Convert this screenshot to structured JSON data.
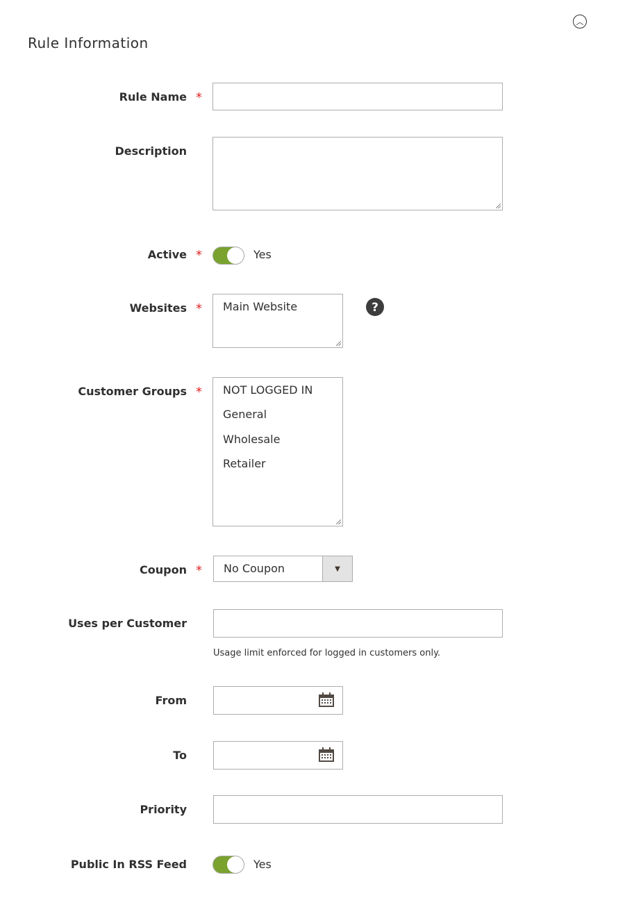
{
  "section": {
    "title": "Rule Information",
    "collapse_icon": "chevron-up-circle-icon"
  },
  "fields": {
    "rule_name": {
      "label": "Rule Name",
      "required": "*",
      "value": ""
    },
    "description": {
      "label": "Description",
      "value": ""
    },
    "active": {
      "label": "Active",
      "required": "*",
      "state": "Yes",
      "on": true
    },
    "websites": {
      "label": "Websites",
      "required": "*",
      "options": [
        "Main Website"
      ],
      "help_icon": "question-circle-icon"
    },
    "customer_groups": {
      "label": "Customer Groups",
      "required": "*",
      "options": [
        "NOT LOGGED IN",
        "General",
        "Wholesale",
        "Retailer"
      ]
    },
    "coupon": {
      "label": "Coupon",
      "required": "*",
      "value": "No Coupon"
    },
    "uses_per_customer": {
      "label": "Uses per Customer",
      "value": "",
      "note": "Usage limit enforced for logged in customers only."
    },
    "from": {
      "label": "From",
      "value": ""
    },
    "to": {
      "label": "To",
      "value": ""
    },
    "priority": {
      "label": "Priority",
      "value": ""
    },
    "rss": {
      "label": "Public In RSS Feed",
      "state": "Yes",
      "on": true
    }
  },
  "colors": {
    "toggle_on": "#79a22e",
    "required": "#e22626"
  }
}
